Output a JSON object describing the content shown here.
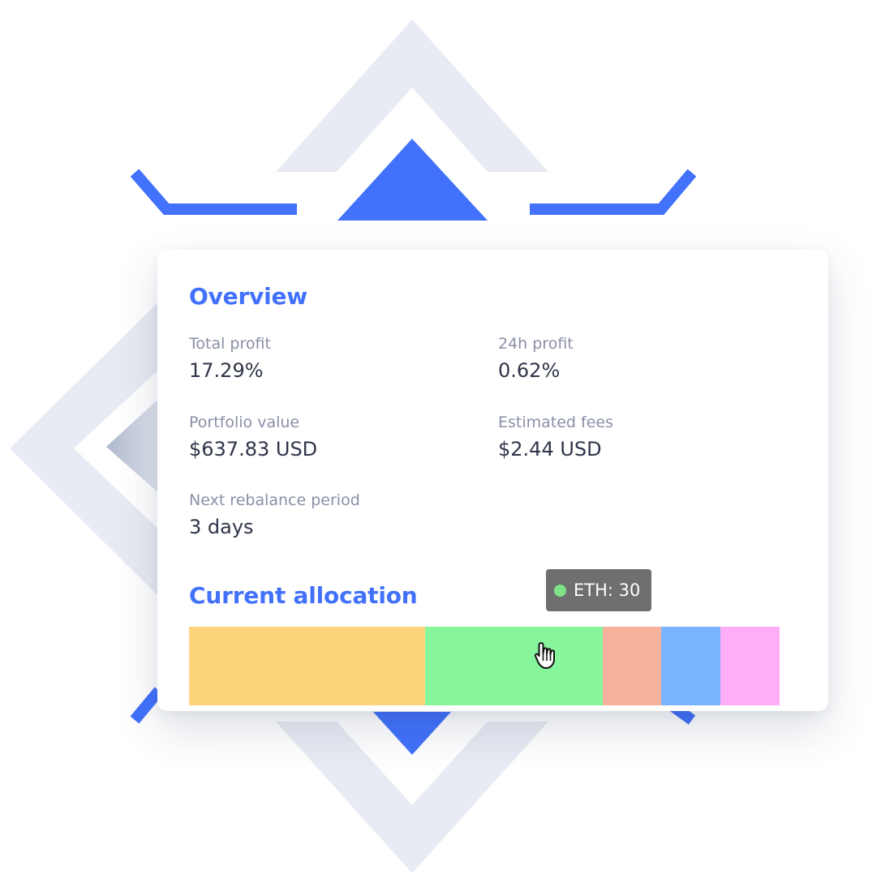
{
  "overview": {
    "title": "Overview",
    "stats": [
      {
        "label": "Total profit",
        "value": "17.29%"
      },
      {
        "label": "24h profit",
        "value": "0.62%"
      },
      {
        "label": "Portfolio value",
        "value": "$637.83 USD"
      },
      {
        "label": "Estimated fees",
        "value": "$2.44 USD"
      },
      {
        "label": "Next rebalance period",
        "value": "3 days"
      }
    ]
  },
  "allocation": {
    "title": "Current allocation",
    "segments": [
      {
        "share": 40,
        "color": "#fdd47b"
      },
      {
        "share": 30,
        "color": "#87f59b"
      },
      {
        "share": 10,
        "color": "#f8b19d"
      },
      {
        "share": 10,
        "color": "#7ab3ff"
      },
      {
        "share": 10,
        "color": "#fdaef6"
      }
    ],
    "tooltip": {
      "text": "ETH: 30",
      "dot_color": "#7ee487"
    }
  },
  "colors": {
    "accent": "#4271fb",
    "background_shapes": "#e8ebf3",
    "text_primary": "#2f3449",
    "text_secondary": "#8a8fa6",
    "tooltip_bg": "#6f6f6f"
  },
  "icons": [
    "hand-pointer-cursor-icon"
  ]
}
